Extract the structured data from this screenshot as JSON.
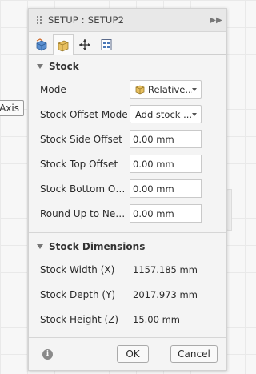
{
  "background": {
    "axis_label": "Axis"
  },
  "dialog": {
    "title": "SETUP : SETUP2",
    "tabs": [
      {
        "icon": "setup-tab-icon",
        "active": false
      },
      {
        "icon": "stock-tab-icon",
        "active": true
      },
      {
        "icon": "post-process-tab-icon",
        "active": false
      },
      {
        "icon": "program-tab-icon",
        "active": false
      }
    ],
    "stock": {
      "header": "Stock",
      "mode": {
        "label": "Mode",
        "value": "Relative..."
      },
      "offset_mode": {
        "label": "Stock Offset Mode",
        "value": "Add stock ..."
      },
      "side_offset": {
        "label": "Stock Side Offset",
        "value": "0.00 mm"
      },
      "top_offset": {
        "label": "Stock Top Offset",
        "value": "0.00 mm"
      },
      "bottom_offset": {
        "label": "Stock Bottom Off...",
        "value": "0.00 mm"
      },
      "round_up": {
        "label": "Round Up to Near...",
        "value": "0.00 mm"
      }
    },
    "dimensions": {
      "header": "Stock Dimensions",
      "width": {
        "label": "Stock Width (X)",
        "value": "1157.185 mm"
      },
      "depth": {
        "label": "Stock Depth (Y)",
        "value": "2017.973 mm"
      },
      "height": {
        "label": "Stock Height (Z)",
        "value": "15.00 mm"
      }
    },
    "footer": {
      "ok": "OK",
      "cancel": "Cancel",
      "info_icon_glyph": "i"
    }
  }
}
